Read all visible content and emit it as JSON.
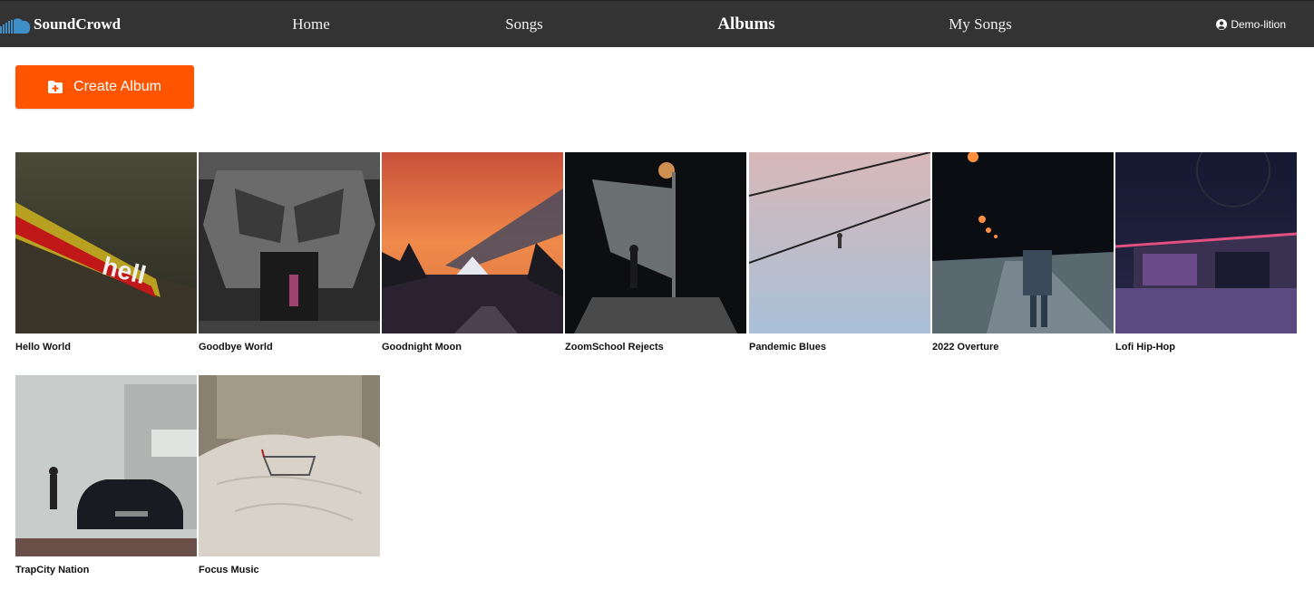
{
  "nav": {
    "brand": "SoundCrowd",
    "links": [
      "Home",
      "Songs",
      "Albums",
      "My Songs"
    ],
    "active": "Albums",
    "user": "Demo-lition"
  },
  "toolbar": {
    "create_label": "Create Album"
  },
  "albums": [
    {
      "title": "Hello World"
    },
    {
      "title": "Goodbye World"
    },
    {
      "title": "Goodnight Moon"
    },
    {
      "title": "ZoomSchool Rejects"
    },
    {
      "title": "Pandemic Blues"
    },
    {
      "title": "2022 Overture"
    },
    {
      "title": "Lofi Hip-Hop"
    },
    {
      "title": "TrapCity Nation"
    },
    {
      "title": "Focus Music"
    }
  ],
  "colors": {
    "nav_bg": "#333333",
    "accent": "#ff5500",
    "logo": "#3e8ec8"
  },
  "icons": {
    "brand": "soundcloud-logo-icon",
    "user": "user-circle-icon",
    "create": "folder-plus-icon"
  }
}
